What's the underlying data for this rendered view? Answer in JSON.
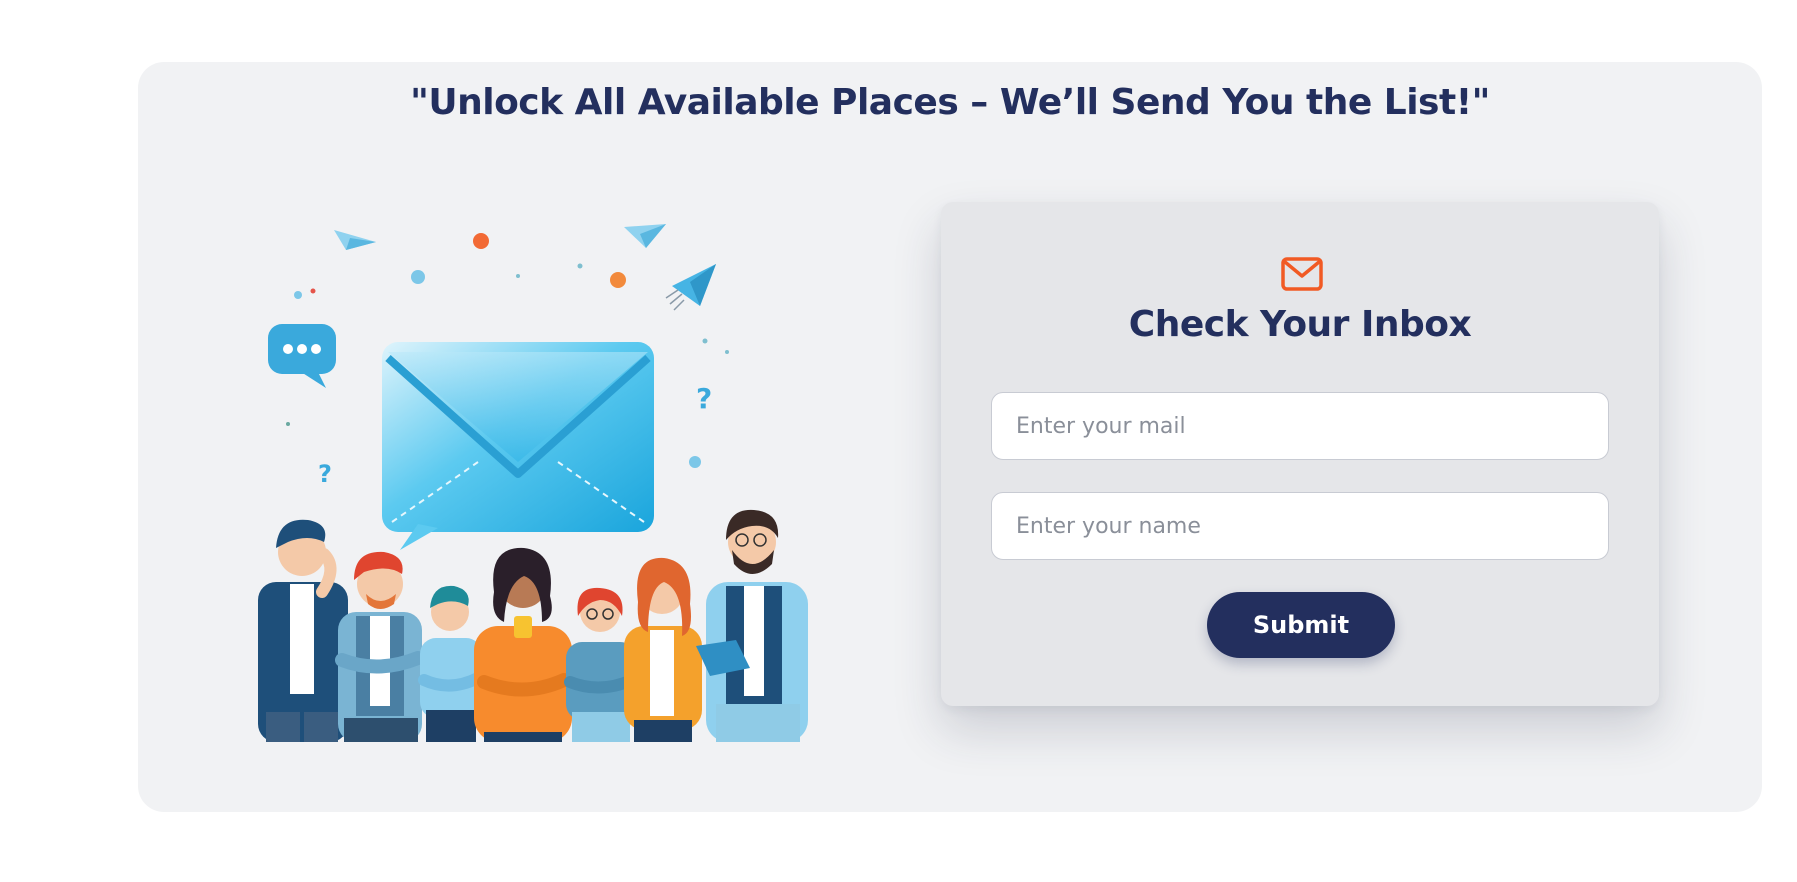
{
  "headline": "\"Unlock All Available Places – We’ll Send You the List!\"",
  "form": {
    "icon": "mail-icon",
    "title": "Check Your Inbox",
    "email_placeholder": "Enter your mail",
    "email_value": "",
    "name_placeholder": "Enter your name",
    "name_value": "",
    "submit_label": "Submit"
  },
  "illustration": {
    "icon": "people-with-envelope-illustration",
    "chat_bubble_icon": "chat-bubble-icon",
    "question_mark_1": "?",
    "question_mark_2": "?"
  },
  "colors": {
    "brand_navy": "#232f5e",
    "accent_orange": "#f15a24",
    "panel_background": "#f1f2f4",
    "card_background": "#e5e6e9",
    "envelope_blue": "#3fb8e8"
  }
}
